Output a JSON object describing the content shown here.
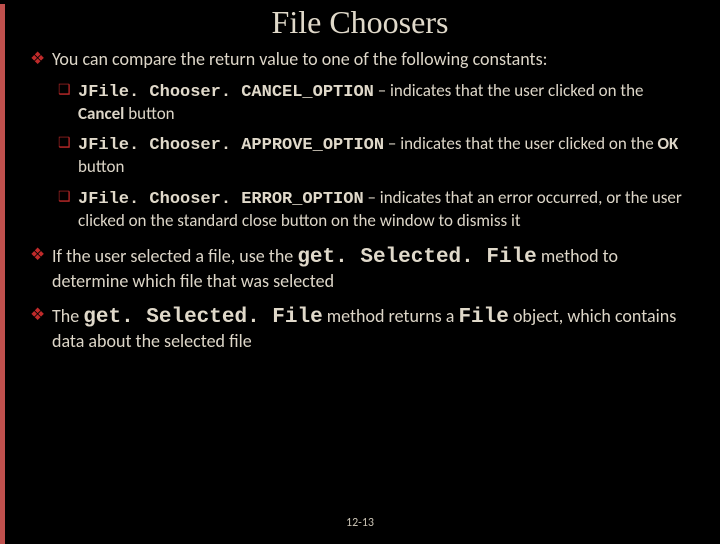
{
  "title": "File Choosers",
  "b1": {
    "text": "You can compare the return value to one of the following constants:"
  },
  "s1": {
    "code": "JFile. Chooser. CANCEL_OPTION",
    "desc1": " – indicates that the user clicked on the ",
    "bold": "Cancel",
    "desc2": " button"
  },
  "s2": {
    "code": "JFile. Chooser. APPROVE_OPTION",
    "desc1": " – indicates that the user clicked on the ",
    "bold": "OK",
    "desc2": " button"
  },
  "s3": {
    "code": "JFile. Chooser. ERROR_OPTION",
    "desc": " – indicates that an error occurred, or the user clicked on the standard close button on the window to dismiss it"
  },
  "b2": {
    "p1": "If the user selected a file, use the ",
    "code": "get. Selected. File",
    "p2": " method to determine which file that was selected"
  },
  "b3": {
    "p1": "The ",
    "code1": "get. Selected. File",
    "p2": " method returns a ",
    "code2": "File",
    "p3": " object, which contains data about the selected file"
  },
  "slidenum": "12-13",
  "marks": {
    "diamond": "❖",
    "square": "❑"
  }
}
